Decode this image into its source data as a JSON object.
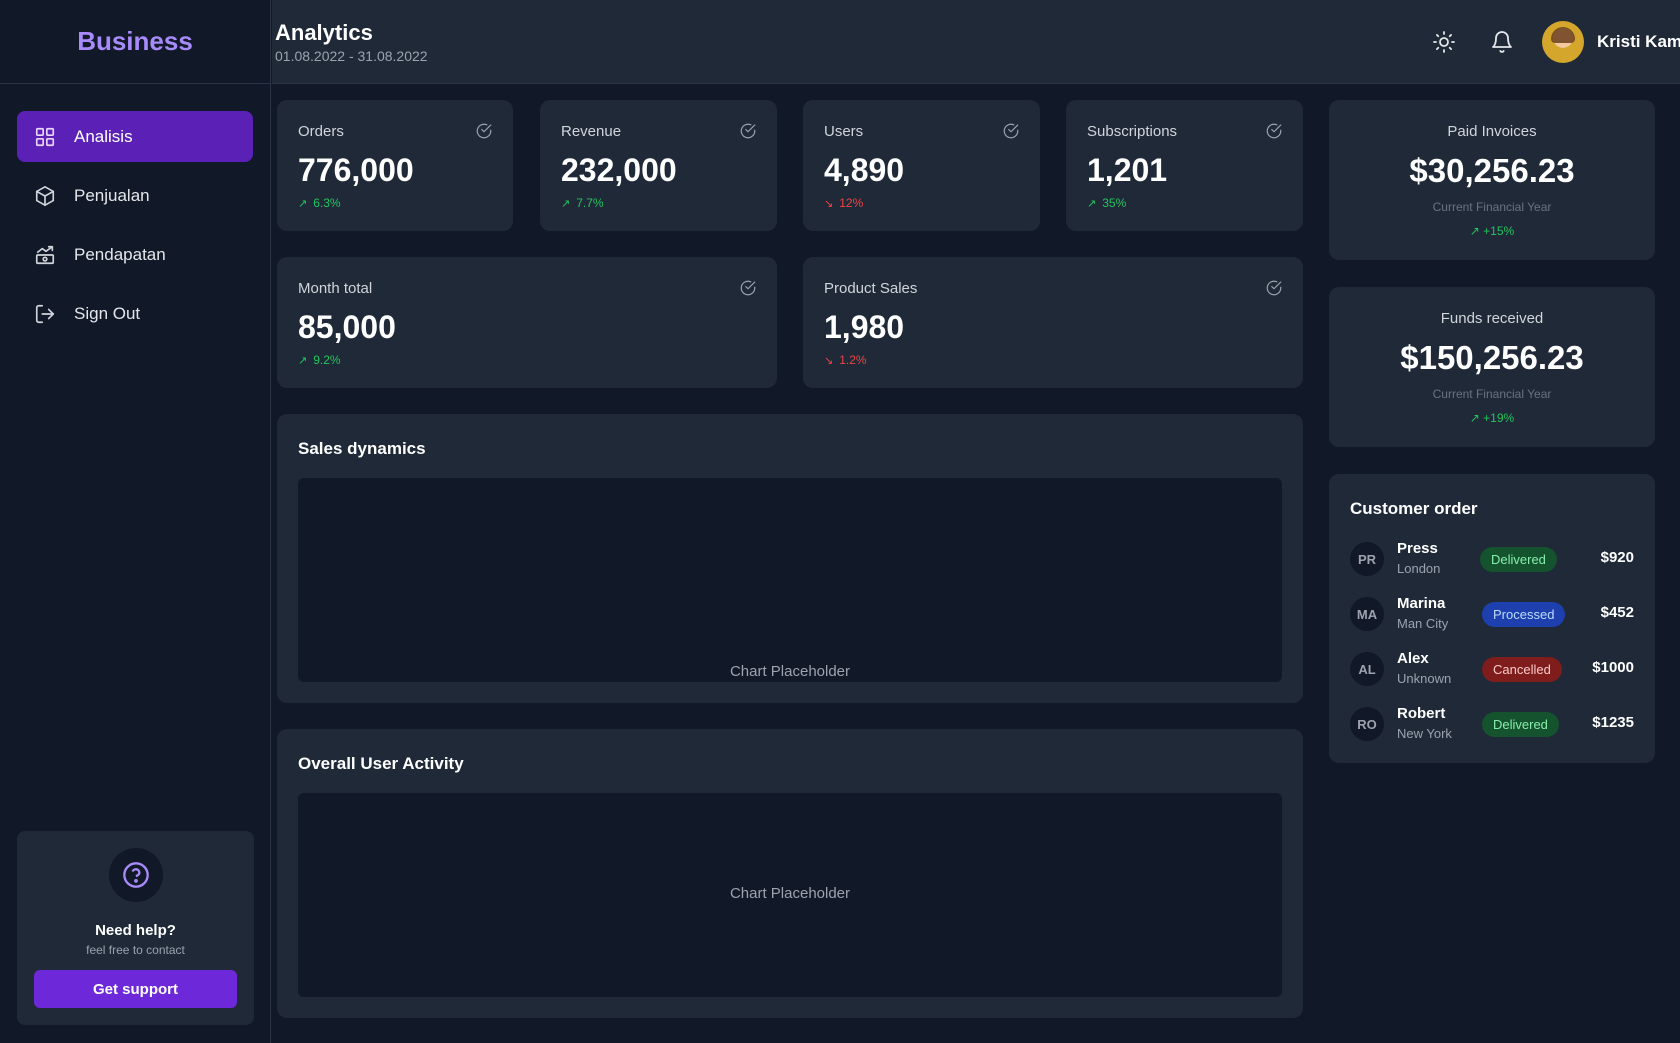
{
  "brand": "Business",
  "nav": [
    {
      "label": "Analisis",
      "icon": "grid-icon",
      "active": true
    },
    {
      "label": "Penjualan",
      "icon": "box-icon",
      "active": false
    },
    {
      "label": "Pendapatan",
      "icon": "income-icon",
      "active": false
    },
    {
      "label": "Sign Out",
      "icon": "sign-out-icon",
      "active": false
    }
  ],
  "help": {
    "title": "Need help?",
    "subtitle": "feel free to contact",
    "button": "Get support"
  },
  "header": {
    "title": "Analytics",
    "date_range": "01.08.2022 - 31.08.2022",
    "user_name": "Kristi Kamylova"
  },
  "stats": {
    "orders": {
      "label": "Orders",
      "value": "776,000",
      "change": "6.3%",
      "trend": "up"
    },
    "revenue": {
      "label": "Revenue",
      "value": "232,000",
      "change": "7.7%",
      "trend": "up"
    },
    "users": {
      "label": "Users",
      "value": "4,890",
      "change": "12%",
      "trend": "down"
    },
    "subscriptions": {
      "label": "Subscriptions",
      "value": "1,201",
      "change": "35%",
      "trend": "up"
    },
    "month_total": {
      "label": "Month total",
      "value": "85,000",
      "change": "9.2%",
      "trend": "up"
    },
    "product_sales": {
      "label": "Product Sales",
      "value": "1,980",
      "change": "1.2%",
      "trend": "down"
    }
  },
  "panels": {
    "sales": {
      "title": "Sales dynamics",
      "placeholder": "Chart Placeholder"
    },
    "activity": {
      "title": "Overall User Activity",
      "placeholder": "Chart Placeholder"
    }
  },
  "finance": {
    "paid": {
      "label": "Paid Invoices",
      "value": "$30,256.23",
      "sub": "Current Financial Year",
      "change": "+15%"
    },
    "funds": {
      "label": "Funds received",
      "value": "$150,256.23",
      "sub": "Current Financial Year",
      "change": "+19%"
    }
  },
  "customer_orders": {
    "title": "Customer order",
    "rows": [
      {
        "initials": "PR",
        "name": "Press",
        "city": "London",
        "status": "Delivered",
        "amount": "$920"
      },
      {
        "initials": "MA",
        "name": "Marina",
        "city": "Man City",
        "status": "Processed",
        "amount": "$452"
      },
      {
        "initials": "AL",
        "name": "Alex",
        "city": "Unknown",
        "status": "Cancelled",
        "amount": "$1000"
      },
      {
        "initials": "RO",
        "name": "Robert",
        "city": "New York",
        "status": "Delivered",
        "amount": "$1235"
      }
    ]
  },
  "colors": {
    "accent": "#6d28d9",
    "brand": "#a78bfa",
    "up": "#22c55e",
    "down": "#ef4444"
  }
}
